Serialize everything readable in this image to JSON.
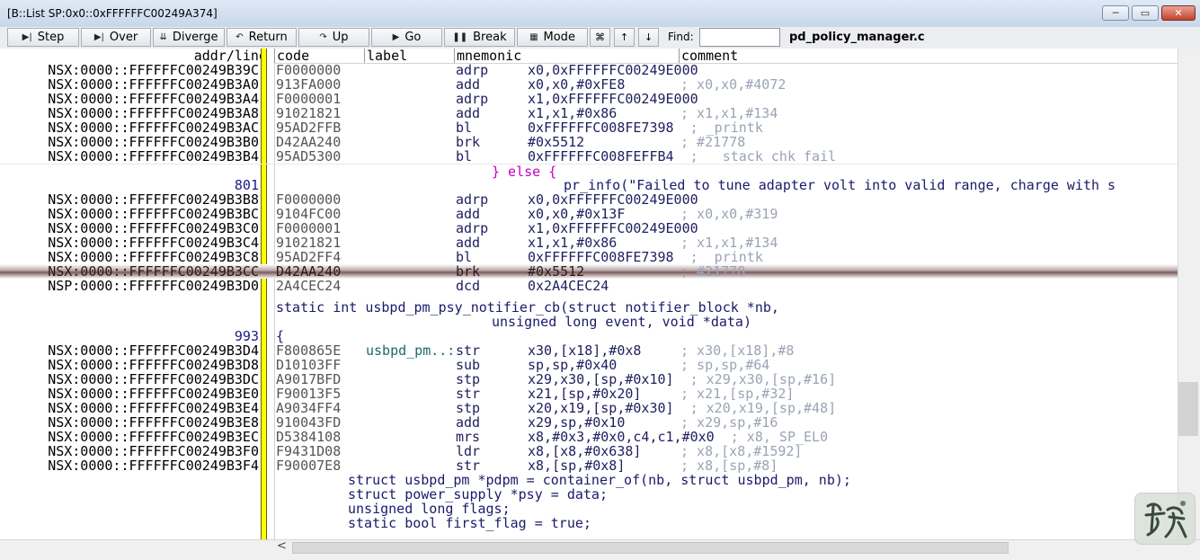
{
  "window": {
    "title": "[B::List SP:0x0::0xFFFFFFC00249A374]",
    "min_label": "─",
    "max_label": "▭",
    "close_label": "✕"
  },
  "toolbar": {
    "step": "Step",
    "over": "Over",
    "diverge": "Diverge",
    "return": "Return",
    "up": "Up",
    "go": "Go",
    "break": "Break",
    "mode": "Mode",
    "find_label": "Find:",
    "find_value": "",
    "file": "pd_policy_manager.c"
  },
  "columns": {
    "addr": "addr/line",
    "code": "code",
    "label": "label",
    "mnemonic": "mnemonic",
    "comment": "comment"
  },
  "rows": [
    {
      "addr": "NSX:0000::FFFFFFC00249B39C",
      "code": "F0000000",
      "label": "",
      "mnem": "adrp",
      "ops": "x0,0xFFFFFFC00249E000",
      "cmt": ""
    },
    {
      "addr": "NSX:0000::FFFFFFC00249B3A0",
      "code": "913FA000",
      "label": "",
      "mnem": "add",
      "ops": "x0,x0,#0xFE8",
      "cmt": "; x0,x0,#4072"
    },
    {
      "addr": "NSX:0000::FFFFFFC00249B3A4",
      "code": "F0000001",
      "label": "",
      "mnem": "adrp",
      "ops": "x1,0xFFFFFFC00249E000",
      "cmt": ""
    },
    {
      "addr": "NSX:0000::FFFFFFC00249B3A8",
      "code": "91021821",
      "label": "",
      "mnem": "add",
      "ops": "x1,x1,#0x86",
      "cmt": "; x1,x1,#134"
    },
    {
      "addr": "NSX:0000::FFFFFFC00249B3AC",
      "code": "95AD2FFB",
      "label": "",
      "mnem": "bl",
      "ops": "0xFFFFFFC008FE7398",
      "cmt": "; _printk"
    },
    {
      "addr": "NSX:0000::FFFFFFC00249B3B0",
      "code": "D42AA240",
      "label": "",
      "mnem": "brk",
      "ops": "#0x5512",
      "cmt": "; #21778"
    },
    {
      "addr": "NSX:0000::FFFFFFC00249B3B4",
      "code": "95AD5300",
      "label": "",
      "mnem": "bl",
      "ops": "0xFFFFFFC008FEFFB4",
      "cmt": "; __stack_chk_fail"
    },
    {
      "src_else": "} else {"
    },
    {
      "line": "801",
      "src": "pr_info(\"Failed to tune adapter volt into valid range, charge with s"
    },
    {
      "addr": "NSX:0000::FFFFFFC00249B3B8",
      "code": "F0000000",
      "label": "",
      "mnem": "adrp",
      "ops": "x0,0xFFFFFFC00249E000",
      "cmt": ""
    },
    {
      "addr": "NSX:0000::FFFFFFC00249B3BC",
      "code": "9104FC00",
      "label": "",
      "mnem": "add",
      "ops": "x0,x0,#0x13F",
      "cmt": "; x0,x0,#319"
    },
    {
      "addr": "NSX:0000::FFFFFFC00249B3C0",
      "code": "F0000001",
      "label": "",
      "mnem": "adrp",
      "ops": "x1,0xFFFFFFC00249E000",
      "cmt": ""
    },
    {
      "addr": "NSX:0000::FFFFFFC00249B3C4",
      "code": "91021821",
      "label": "",
      "mnem": "add",
      "ops": "x1,x1,#0x86",
      "cmt": "; x1,x1,#134"
    },
    {
      "addr": "NSX:0000::FFFFFFC00249B3C8",
      "code": "95AD2FF4",
      "label": "",
      "mnem": "bl",
      "ops": "0xFFFFFFC008FE7398",
      "cmt": "; _printk"
    },
    {
      "addr": "NSX:0000::FFFFFFC00249B3CC",
      "code": "D42AA240",
      "label": "",
      "mnem": "brk",
      "ops": "#0x5512",
      "cmt": "; #21778"
    },
    {
      "addr": "NSP:0000::FFFFFFC00249B3D0",
      "code": "2A4CEC24",
      "label": "",
      "mnem": "dcd",
      "ops": "0x2A4CEC24",
      "cmt": ""
    },
    {
      "src1": "static int usbpd_pm_psy_notifier_cb(struct notifier_block *nb,"
    },
    {
      "src2": "unsigned long event, void *data)"
    },
    {
      "line": "993",
      "brace": "{"
    },
    {
      "addr": "NSX:0000::FFFFFFC00249B3D4",
      "code": "F800865E",
      "label": "usbpd_pm..:",
      "mnem": "str",
      "ops": "x30,[x18],#0x8",
      "cmt": "; x30,[x18],#8"
    },
    {
      "addr": "NSX:0000::FFFFFFC00249B3D8",
      "code": "D10103FF",
      "label": "",
      "mnem": "sub",
      "ops": "sp,sp,#0x40",
      "cmt": "; sp,sp,#64"
    },
    {
      "addr": "NSX:0000::FFFFFFC00249B3DC",
      "code": "A9017BFD",
      "label": "",
      "mnem": "stp",
      "ops": "x29,x30,[sp,#0x10]",
      "cmt": "; x29,x30,[sp,#16]"
    },
    {
      "addr": "NSX:0000::FFFFFFC00249B3E0",
      "code": "F90013F5",
      "label": "",
      "mnem": "str",
      "ops": "x21,[sp,#0x20]",
      "cmt": "; x21,[sp,#32]"
    },
    {
      "addr": "NSX:0000::FFFFFFC00249B3E4",
      "code": "A9034FF4",
      "label": "",
      "mnem": "stp",
      "ops": "x20,x19,[sp,#0x30]",
      "cmt": "; x20,x19,[sp,#48]"
    },
    {
      "addr": "NSX:0000::FFFFFFC00249B3E8",
      "code": "910043FD",
      "label": "",
      "mnem": "add",
      "ops": "x29,sp,#0x10",
      "cmt": "; x29,sp,#16"
    },
    {
      "addr": "NSX:0000::FFFFFFC00249B3EC",
      "code": "D5384108",
      "label": "",
      "mnem": "mrs",
      "ops": "x8,#0x3,#0x0,c4,c1,#0x0",
      "cmt": "; x8, SP_EL0"
    },
    {
      "addr": "NSX:0000::FFFFFFC00249B3F0",
      "code": "F9431D08",
      "label": "",
      "mnem": "ldr",
      "ops": "x8,[x8,#0x638]",
      "cmt": "; x8,[x8,#1592]"
    },
    {
      "addr": "NSX:0000::FFFFFFC00249B3F4",
      "code": "F90007E8",
      "label": "",
      "mnem": "str",
      "ops": "x8,[sp,#0x8]",
      "cmt": "; x8,[sp,#8]"
    },
    {
      "srcA": "struct usbpd_pm *pdpm = container_of(nb, struct usbpd_pm, nb);"
    },
    {
      "srcB": "struct power_supply *psy = data;"
    },
    {
      "srcC": "unsigned long flags;"
    },
    {
      "srcD": "static bool first_flag = true;"
    }
  ],
  "scroll": {
    "left_arrow": "<"
  },
  "colors": {
    "accent_bar": "#ffff00",
    "comment": "#9aa3b5",
    "brace": "#c000c0"
  }
}
